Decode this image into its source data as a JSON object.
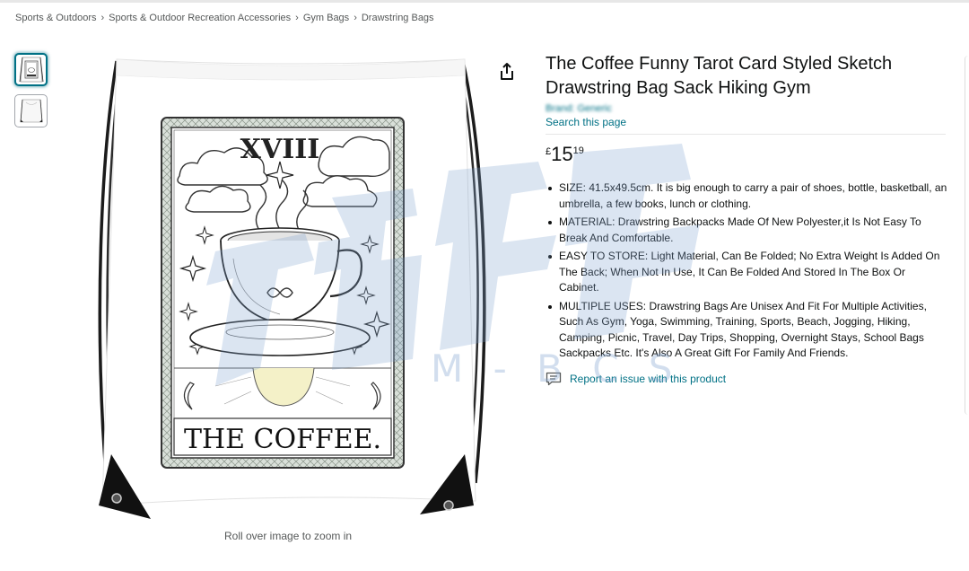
{
  "breadcrumb": {
    "items": [
      "Sports & Outdoors",
      "Sports & Outdoor Recreation Accessories",
      "Gym Bags",
      "Drawstring Bags"
    ],
    "separator": "›"
  },
  "product": {
    "title": "The Coffee Funny Tarot Card Styled Sketch Drawstring Bag Sack Hiking Gym",
    "brand": "Brand: Generic",
    "search_link": "Search this page",
    "price": {
      "symbol": "£",
      "whole": "15",
      "fraction": "19"
    },
    "bullets": [
      "SIZE: 41.5x49.5cm. It is big enough to carry a pair of shoes, bottle, basketball, an umbrella, a few books, lunch or clothing.",
      "MATERIAL: Drawstring Backpacks Made Of New Polyester,it Is Not Easy To Break And Comfortable.",
      "EASY TO STORE: Light Material, Can Be Folded; No Extra Weight Is Added On The Back; When Not In Use, It Can Be Folded And Stored In The Box Or Cabinet.",
      "MULTIPLE USES: Drawstring Bags Are Unisex And Fit For Multiple Activities, Such As Gym, Yoga, Swimming, Training, Sports, Beach, Jogging, Hiking, Camping, Picnic, Travel, Day Trips, Shopping, Overnight Stays, School Bags Sackpacks Etc. It's Also A Great Gift For Family And Friends."
    ],
    "report_label": "Report an issue with this product"
  },
  "gallery": {
    "zoom_hint": "Roll over image to zoom in",
    "card_numeral": "XVIII",
    "card_caption": "THE COFFEE.",
    "thumbnails": [
      "front-view-thumbnail",
      "back-view-thumbnail"
    ]
  },
  "icons": {
    "share": "share-icon",
    "report": "report-icon"
  },
  "colors": {
    "link": "#007185",
    "text": "#0f1111",
    "muted": "#565959"
  },
  "watermark": {
    "text": "M - B C S"
  }
}
